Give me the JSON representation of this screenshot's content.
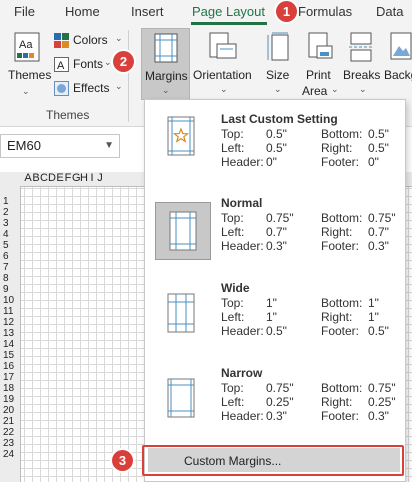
{
  "tabs": [
    "File",
    "Home",
    "Insert",
    "Page Layout",
    "Formulas",
    "Data"
  ],
  "active_tab": "Page Layout",
  "ribbon": {
    "themes_label": "Themes",
    "colors_label": "Colors",
    "fonts_label": "Fonts",
    "effects_label": "Effects",
    "group_label": "Themes",
    "margins_label": "Margins",
    "orientation_label": "Orientation",
    "size_label": "Size",
    "print_area_label_1": "Print",
    "print_area_label_2": "Area",
    "breaks_label": "Breaks",
    "background_label": "Backg"
  },
  "name_box": "EM60",
  "columns": [
    "A",
    "B",
    "C",
    "D",
    "E",
    "F",
    "G",
    "H",
    "I",
    "J"
  ],
  "rows": [
    "1",
    "2",
    "3",
    "4",
    "5",
    "6",
    "7",
    "8",
    "9",
    "10",
    "11",
    "12",
    "13",
    "14",
    "15",
    "16",
    "17",
    "18",
    "19",
    "20",
    "21",
    "22",
    "23",
    "24"
  ],
  "callouts": [
    "1",
    "2",
    "3"
  ],
  "margin_options": [
    {
      "title": "Last Custom Setting",
      "top": "0.5\"",
      "bottom": "0.5\"",
      "left": "0.5\"",
      "right": "0.5\"",
      "header": "0\"",
      "footer": "0\""
    },
    {
      "title": "Normal",
      "top": "0.75\"",
      "bottom": "0.75\"",
      "left": "0.7\"",
      "right": "0.7\"",
      "header": "0.3\"",
      "footer": "0.3\""
    },
    {
      "title": "Wide",
      "top": "1\"",
      "bottom": "1\"",
      "left": "1\"",
      "right": "1\"",
      "header": "0.5\"",
      "footer": "0.5\""
    },
    {
      "title": "Narrow",
      "top": "0.75\"",
      "bottom": "0.75\"",
      "left": "0.25\"",
      "right": "0.25\"",
      "header": "0.3\"",
      "footer": "0.3\""
    }
  ],
  "labels": {
    "top": "Top:",
    "bottom": "Bottom:",
    "left": "Left:",
    "right": "Right:",
    "header": "Header:",
    "footer": "Footer:"
  },
  "custom_margins_label": "Custom Margins...",
  "colors": {
    "accent": "#217346",
    "callout": "#d9403b",
    "guide": "#4a90c2"
  }
}
